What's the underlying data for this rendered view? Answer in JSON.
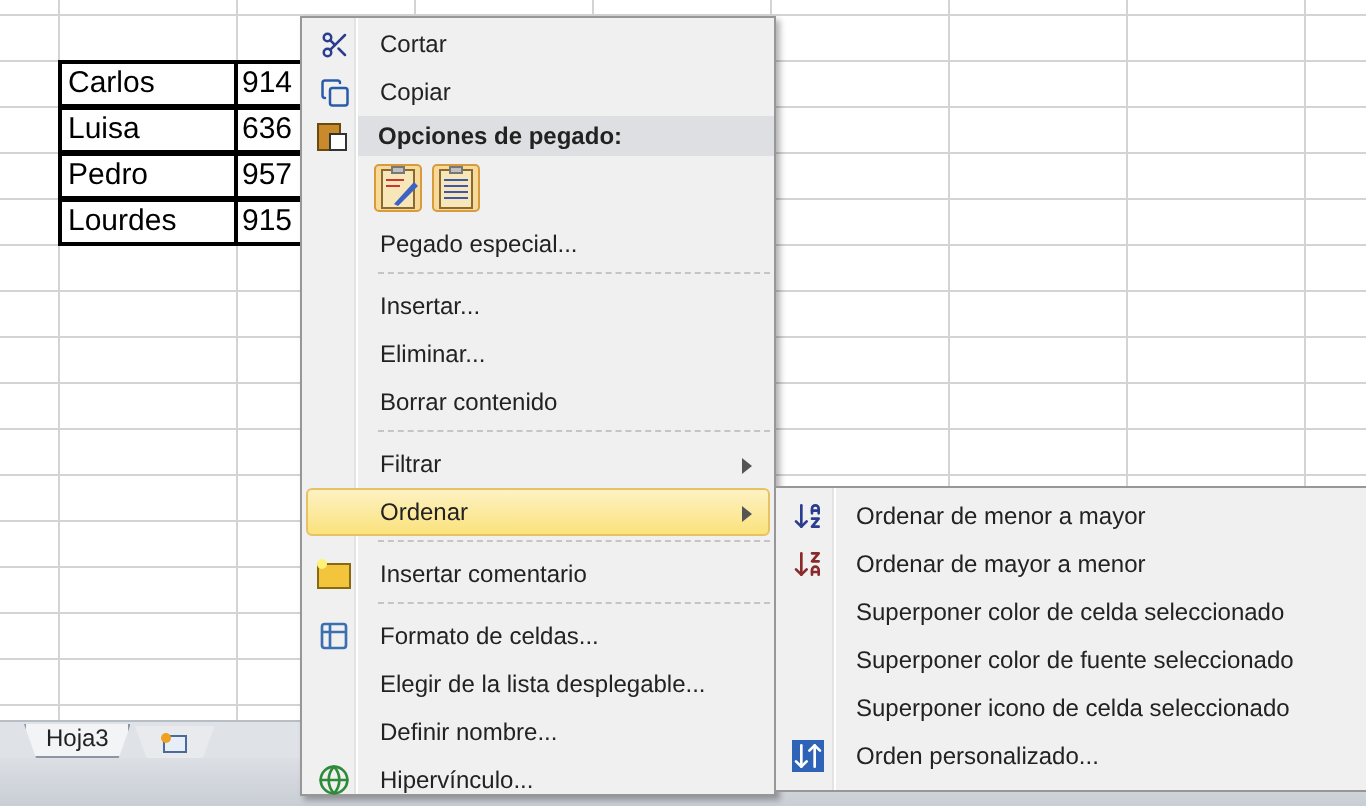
{
  "sheet": {
    "rows": [
      {
        "name": "Carlos",
        "number": "914"
      },
      {
        "name": "Luisa",
        "number": "636"
      },
      {
        "name": "Pedro",
        "number": "957"
      },
      {
        "name": "Lourdes",
        "number": "915"
      }
    ]
  },
  "sheet_tabs": [
    {
      "kind": "sheet",
      "label": "Hoja3"
    },
    {
      "kind": "insert"
    }
  ],
  "context_menu": {
    "items": [
      {
        "kind": "item",
        "label": "Cortar",
        "selected": false,
        "submenu": false
      },
      {
        "kind": "item",
        "label": "Copiar",
        "selected": false,
        "submenu": false
      },
      {
        "kind": "header",
        "label": "Opciones de pegado:"
      },
      {
        "kind": "paste_options"
      },
      {
        "kind": "item",
        "label": "Pegado especial...",
        "selected": false,
        "submenu": false
      },
      {
        "kind": "separator"
      },
      {
        "kind": "item",
        "label": "Insertar...",
        "selected": false,
        "submenu": false
      },
      {
        "kind": "item",
        "label": "Eliminar...",
        "selected": false,
        "submenu": false
      },
      {
        "kind": "item",
        "label": "Borrar contenido",
        "selected": false,
        "submenu": false
      },
      {
        "kind": "separator"
      },
      {
        "kind": "item",
        "label": "Filtrar",
        "selected": false,
        "submenu": true
      },
      {
        "kind": "item",
        "label": "Ordenar",
        "selected": true,
        "submenu": true
      },
      {
        "kind": "separator"
      },
      {
        "kind": "item",
        "label": "Insertar comentario",
        "selected": false,
        "submenu": false
      },
      {
        "kind": "separator"
      },
      {
        "kind": "item",
        "label": "Formato de celdas...",
        "selected": false,
        "submenu": false
      },
      {
        "kind": "item",
        "label": "Elegir de la lista desplegable...",
        "selected": false,
        "submenu": false
      },
      {
        "kind": "item",
        "label": "Definir nombre...",
        "selected": false,
        "submenu": false
      },
      {
        "kind": "item",
        "label": "Hipervínculo...",
        "selected": false,
        "submenu": false
      }
    ]
  },
  "submenu": {
    "items": [
      {
        "label": "Ordenar de menor a mayor"
      },
      {
        "label": "Ordenar de mayor a menor"
      },
      {
        "label": "Superponer color de celda seleccionado"
      },
      {
        "label": "Superponer color de fuente seleccionado"
      },
      {
        "label": "Superponer icono de celda seleccionado"
      },
      {
        "label": "Orden personalizado..."
      }
    ]
  }
}
